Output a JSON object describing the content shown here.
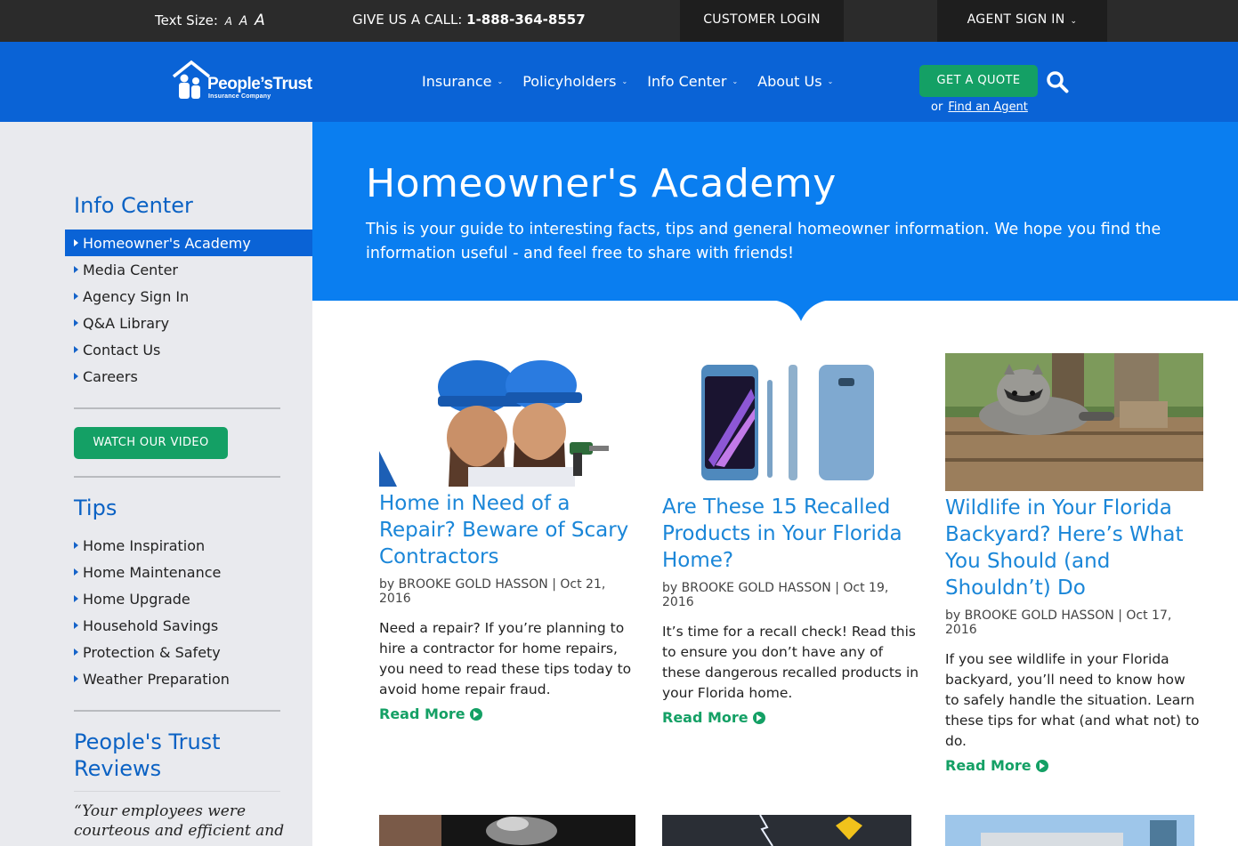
{
  "topbar": {
    "text_size_label": "Text Size:",
    "size_small": "A",
    "size_medium": "A",
    "size_large": "A",
    "call_label": "GIVE US A CALL:",
    "phone": "1-888-364-8557",
    "customer_login": "CUSTOMER LOGIN",
    "agent_sign_in": "AGENT SIGN IN"
  },
  "header": {
    "logo_name": "People’sTrust",
    "logo_sub": "Insurance Company",
    "nav": [
      {
        "label": "Insurance"
      },
      {
        "label": "Policyholders"
      },
      {
        "label": "Info Center"
      },
      {
        "label": "About Us"
      }
    ],
    "quote_button": "GET A QUOTE",
    "or_text": "or",
    "find_agent": "Find an Agent"
  },
  "sidebar": {
    "info_heading": "Info Center",
    "info_items": [
      {
        "label": "Homeowner's Academy"
      },
      {
        "label": "Media Center"
      },
      {
        "label": "Agency Sign In"
      },
      {
        "label": "Q&A Library"
      },
      {
        "label": "Contact Us"
      },
      {
        "label": "Careers"
      }
    ],
    "video_button": "WATCH OUR VIDEO",
    "tips_heading": "Tips",
    "tips_items": [
      {
        "label": "Home Inspiration"
      },
      {
        "label": "Home Maintenance"
      },
      {
        "label": "Home Upgrade"
      },
      {
        "label": "Household Savings"
      },
      {
        "label": "Protection & Safety"
      },
      {
        "label": "Weather Preparation"
      }
    ],
    "reviews_heading_line1": "People's Trust",
    "reviews_heading_line2": "Reviews",
    "review_quote": "“Your employees were courteous and efficient and"
  },
  "hero": {
    "title": "Homeowner's Academy",
    "description": "This is your guide to interesting facts, tips and general homeowner information. We hope you find the information useful - and feel free to share with friends!"
  },
  "articles": [
    {
      "title": "Home in Need of a Repair? Beware of Scary Contractors",
      "author_prefix": "by",
      "author": "BROOKE GOLD HASSON",
      "date": "Oct 21, 2016",
      "excerpt": "Need a repair? If you’re planning to hire a contractor for home repairs, you need to read these tips today to avoid home repair fraud.",
      "read_more": "Read More"
    },
    {
      "title": "Are These 15 Recalled Products in Your Florida Home?",
      "author_prefix": "by",
      "author": "BROOKE GOLD HASSON",
      "date": "Oct 19, 2016",
      "excerpt": "It’s time for a recall check! Read this to ensure you don’t have any of these dangerous recalled products in your Florida home.",
      "read_more": "Read More"
    },
    {
      "title": "Wildlife in Your Florida Backyard? Here’s What You Should (and Shouldn’t) Do",
      "author_prefix": "by",
      "author": "BROOKE GOLD HASSON",
      "date": "Oct 17, 2016",
      "excerpt": "If you see wildlife in your Florida backyard, you’ll need to know how to safely handle the situation. Learn these tips for what (and what not) to do.",
      "read_more": "Read More"
    }
  ],
  "colors": {
    "topbar": "#2b2b2b",
    "nav_blue": "#0a63d6",
    "hero_blue": "#0a7ef0",
    "green": "#14a065",
    "link_blue": "#1a86d8"
  }
}
